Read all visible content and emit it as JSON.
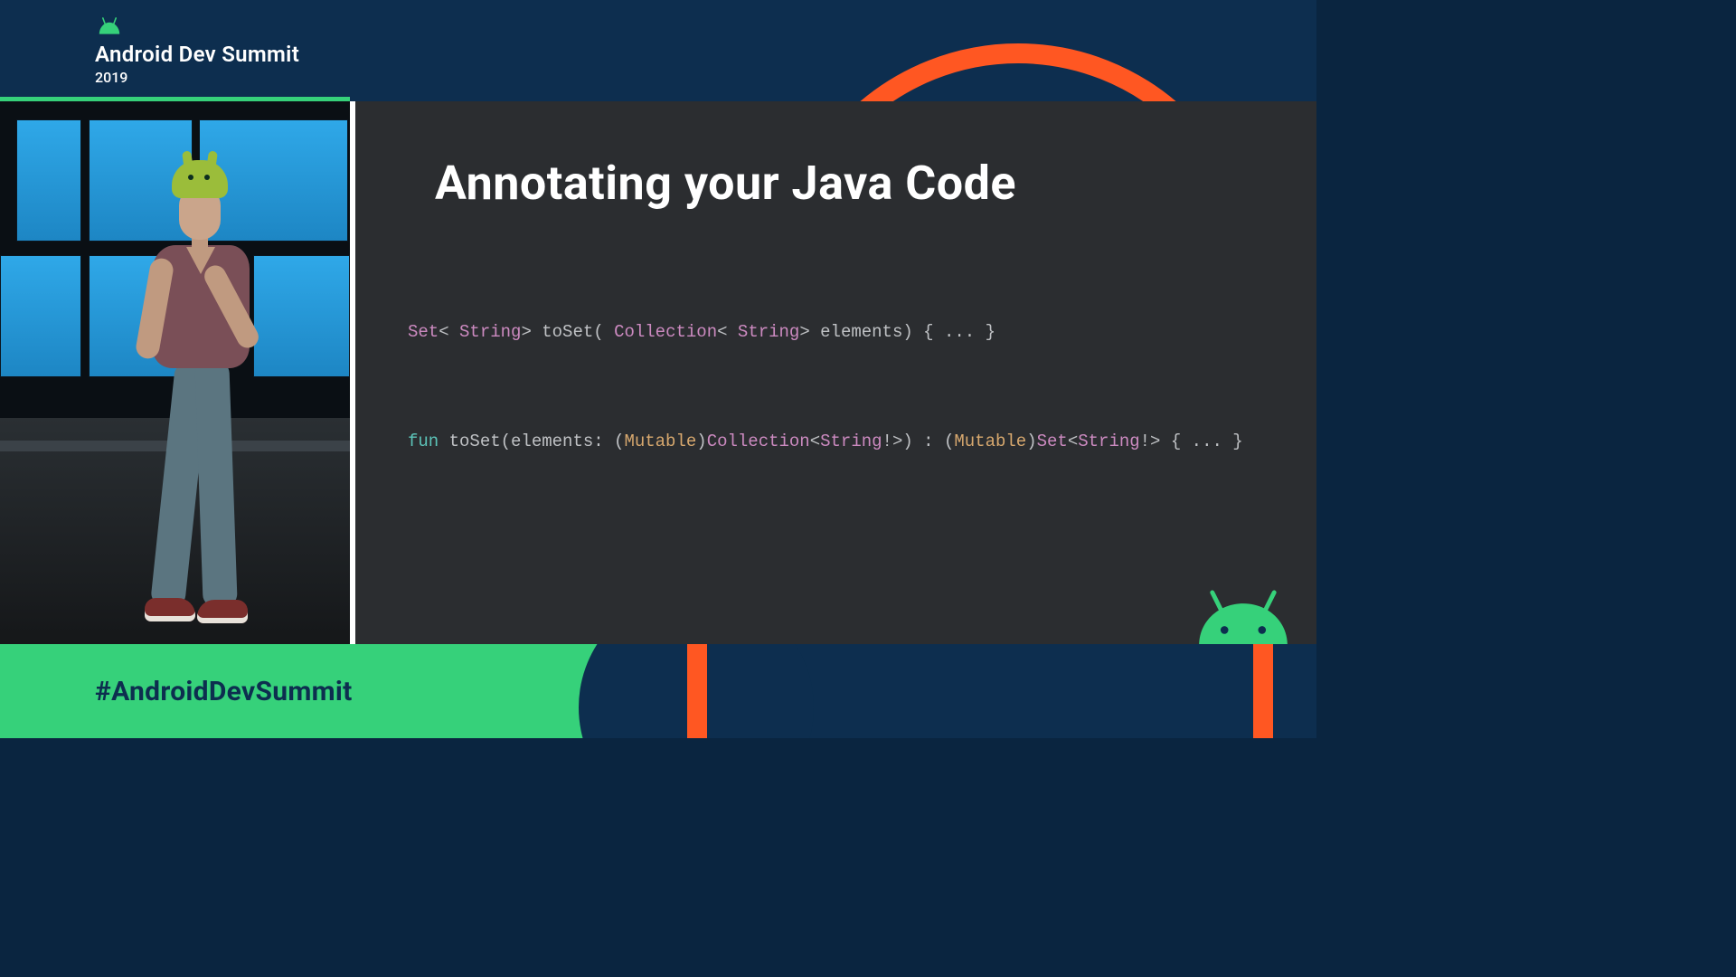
{
  "header": {
    "title": "Android Dev Summit",
    "year": "2019"
  },
  "slide": {
    "title": "Annotating your Java Code",
    "code_java": {
      "t1": "Set",
      "t2": "< ",
      "t3": "String",
      "t4": "> toSet( ",
      "t5": "Collection",
      "t6": "< ",
      "t7": "String",
      "t8": "> elements) { ... }"
    },
    "code_kotlin": {
      "t1": "fun",
      "t2": " toSet(elements: (",
      "t3": "Mutable",
      "t4": ")",
      "t5": "Collection",
      "t6": "<",
      "t7": "String",
      "t8": "!>) : (",
      "t9": "Mutable",
      "t10": ")",
      "t11": "Set",
      "t12": "<",
      "t13": "String",
      "t14": "!> { ... }"
    }
  },
  "footer": {
    "hashtag": "#AndroidDevSummit"
  },
  "colors": {
    "navy": "#0d2e4f",
    "green": "#36d17a",
    "orange": "#ff5722",
    "slide_bg": "#2b2d30",
    "code_type": "#cc8ac0",
    "code_keyword": "#5cc3b8",
    "code_annotation": "#d7a86e"
  }
}
